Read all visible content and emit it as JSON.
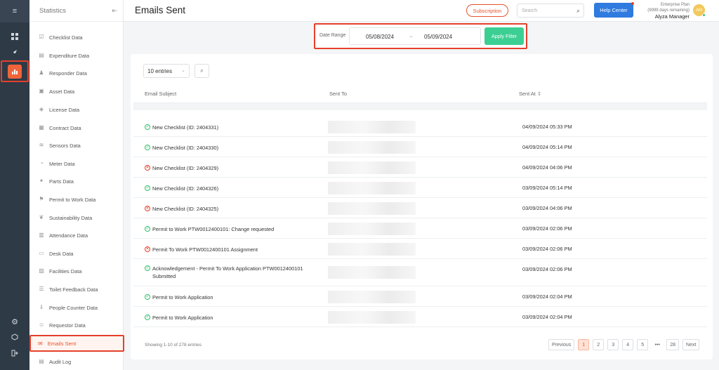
{
  "app": {
    "page_title": "Emails Sent"
  },
  "sidebar": {
    "title": "Statistics",
    "items": [
      {
        "label": "Checklist Data",
        "icon": "checklist-icon"
      },
      {
        "label": "Expenditure Data",
        "icon": "expenditure-icon"
      },
      {
        "label": "Responder Data",
        "icon": "responder-icon"
      },
      {
        "label": "Asset Data",
        "icon": "asset-icon"
      },
      {
        "label": "License Data",
        "icon": "license-icon"
      },
      {
        "label": "Contract Data",
        "icon": "contract-icon"
      },
      {
        "label": "Sensors Data",
        "icon": "sensor-icon"
      },
      {
        "label": "Meter Data",
        "icon": "meter-icon"
      },
      {
        "label": "Parts Data",
        "icon": "parts-icon"
      },
      {
        "label": "Permit to Work Data",
        "icon": "permit-icon"
      },
      {
        "label": "Sustainability Data",
        "icon": "sustainability-icon"
      },
      {
        "label": "Attendance Data",
        "icon": "attendance-icon"
      },
      {
        "label": "Desk Data",
        "icon": "desk-icon"
      },
      {
        "label": "Facilities Data",
        "icon": "facilities-icon"
      },
      {
        "label": "Toilet Feedback Data",
        "icon": "feedback-icon"
      },
      {
        "label": "People Counter Data",
        "icon": "people-counter-icon"
      },
      {
        "label": "Requestor Data",
        "icon": "requestor-icon"
      }
    ],
    "active_item": "Emails Sent",
    "last_item": "Audit Log"
  },
  "topbar": {
    "subscription": "Subscription",
    "search_placeholder": "Search",
    "help": "Help Center",
    "plan": "Enterprise Plan",
    "days": "(9999 days remaining)",
    "user": "Alyza Manager",
    "initials": "AM"
  },
  "filter": {
    "label": "Date Range",
    "from": "05/08/2024",
    "sep": "~",
    "to": "05/09/2024",
    "apply": "Apply Filter"
  },
  "table": {
    "entries": "10 entries",
    "headers": {
      "subject": "Email Subject",
      "to": "Sent To",
      "at": "Sent At"
    },
    "rows": [
      {
        "subject": "New Checklist (ID: 2404331)",
        "status": "ok",
        "at": "04/09/2024 05:33 PM"
      },
      {
        "subject": "New Checklist (ID: 2404330)",
        "status": "ok",
        "at": "04/09/2024 05:14 PM"
      },
      {
        "subject": "New Checklist (ID: 2404329)",
        "status": "fail",
        "at": "04/09/2024 04:06 PM"
      },
      {
        "subject": "New Checklist (ID: 2404326)",
        "status": "ok",
        "at": "03/09/2024 05:14 PM"
      },
      {
        "subject": "New Checklist (ID: 2404325)",
        "status": "fail",
        "at": "03/09/2024 04:06 PM"
      },
      {
        "subject": "Permit to Work PTW0012400101: Change requested",
        "status": "ok",
        "at": "03/09/2024 02:06 PM"
      },
      {
        "subject": "Permit To Work PTW0012400101 Assignment",
        "status": "fail",
        "at": "03/09/2024 02:06 PM"
      },
      {
        "subject": "Acknowledgement - Permit To Work Application PTW0012400101 Submitted",
        "status": "ok",
        "at": "03/09/2024 02:06 PM"
      },
      {
        "subject": "Permit to Work Application",
        "status": "ok",
        "at": "03/09/2024 02:04 PM"
      },
      {
        "subject": "Permit to Work Application",
        "status": "ok",
        "at": "03/09/2024 02:04 PM"
      }
    ],
    "showing": "Showing 1-10 of 278 entries"
  },
  "pagination": {
    "prev": "Previous",
    "pages": [
      "1",
      "2",
      "3",
      "4",
      "5"
    ],
    "dots": "•••",
    "last": "28",
    "next": "Next"
  }
}
